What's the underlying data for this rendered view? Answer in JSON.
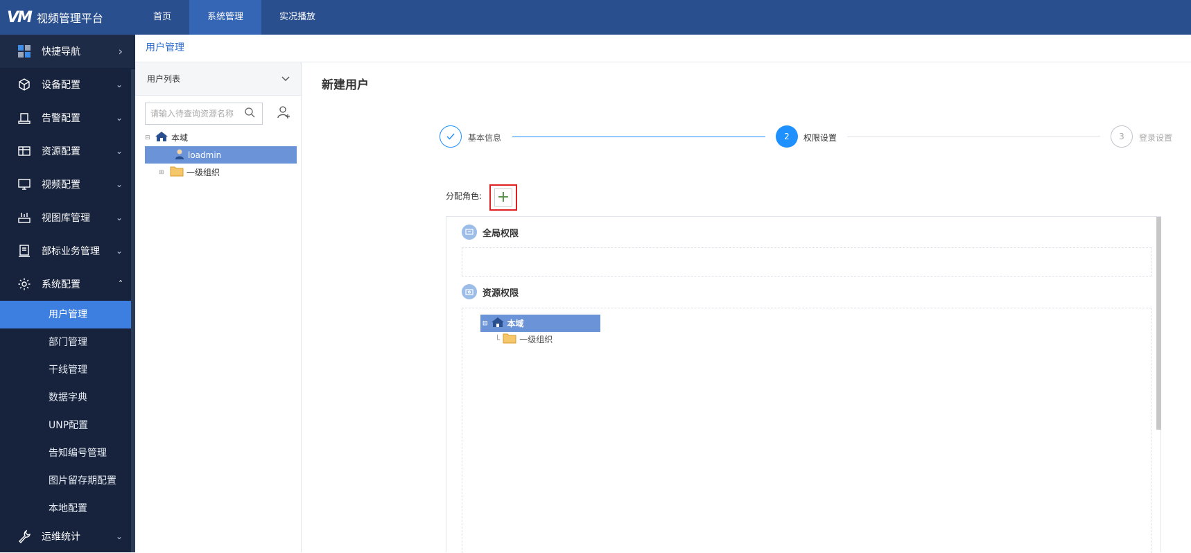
{
  "app": {
    "logo": "VM",
    "title": "视频管理平台"
  },
  "topnav": [
    {
      "label": "首页"
    },
    {
      "label": "系统管理"
    },
    {
      "label": "实况播放"
    }
  ],
  "sidebar": {
    "items": [
      {
        "label": "快捷导航",
        "icon": "grid-icon"
      },
      {
        "label": "设备配置",
        "icon": "cube-icon"
      },
      {
        "label": "告警配置",
        "icon": "alarm-icon"
      },
      {
        "label": "资源配置",
        "icon": "resource-icon"
      },
      {
        "label": "视频配置",
        "icon": "monitor-icon"
      },
      {
        "label": "视图库管理",
        "icon": "library-icon"
      },
      {
        "label": "部标业务管理",
        "icon": "document-icon"
      },
      {
        "label": "系统配置",
        "icon": "gear-icon"
      }
    ],
    "sub_items": [
      {
        "label": "用户管理"
      },
      {
        "label": "部门管理"
      },
      {
        "label": "干线管理"
      },
      {
        "label": "数据字典"
      },
      {
        "label": "UNP配置"
      },
      {
        "label": "告知编号管理"
      },
      {
        "label": "图片留存期配置"
      },
      {
        "label": "本地配置"
      }
    ],
    "bottom_item": {
      "label": "运维统计",
      "icon": "wrench-icon"
    }
  },
  "breadcrumb": "用户管理",
  "user_panel": {
    "title": "用户列表",
    "search_placeholder": "请输入待查询资源名称",
    "tree": {
      "root": "本域",
      "user": "loadmin",
      "group": "一级组织"
    }
  },
  "main": {
    "title": "新建用户",
    "steps": [
      {
        "label": "基本信息",
        "number": ""
      },
      {
        "label": "权限设置",
        "number": "2"
      },
      {
        "label": "登录设置",
        "number": "3"
      }
    ],
    "role_label": "分配角色:",
    "global_perm": "全局权限",
    "resource_perm": "资源权限",
    "resource_tree": {
      "root": "本域",
      "child": "一级组织"
    }
  },
  "colors": {
    "topbar": "#2a4f8f",
    "sidebar": "#17233d",
    "accent": "#3d7fe0",
    "step_active": "#1e90ff"
  }
}
